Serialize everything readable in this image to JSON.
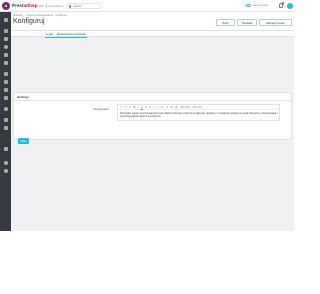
{
  "header": {
    "logo_brand": "Presta",
    "logo_brand_accent": "Shop",
    "version": "8.1",
    "quick_access": "Quick Access",
    "search_placeholder": "Search",
    "view_store": "View my store",
    "avatar_color": "#25b9d7",
    "accent": "#df0067"
  },
  "sidebar": {
    "icons": [
      "dashboard-icon",
      "orders-icon",
      "catalog-icon",
      "customers-icon",
      "support-icon",
      "stats-icon",
      "modules-icon",
      "design-icon",
      "shipping-icon",
      "payment-icon",
      "international-icon",
      "parameters-icon",
      "advanced-icon",
      "collapse-icon",
      "help-icon",
      "info-icon"
    ]
  },
  "page": {
    "breadcrumb": [
      "Modules",
      "Customer Reassurance",
      "Configure"
    ],
    "title": "Konfiguruj",
    "buttons": {
      "back": "Wróć",
      "translate": "Translate",
      "manage_hooks": "Manage hooks"
    },
    "tab": "Legal ... Reassurance Concepts"
  },
  "card": {
    "header": "Settings",
    "field_label": "Content text",
    "required_mark": "*",
    "toolbar": [
      "↶",
      "↷",
      "A",
      "B",
      "I",
      "U",
      "≡",
      "≡",
      "•",
      "1.",
      "⇤",
      "⇥",
      "⊞",
      "🔗",
      "&lt;/&gt;",
      "Format"
    ],
    "editor_text": "Wszystkie zgody na przetwarzanie wszystkich informacji i danych w zakresie zgodnym z przepisami prawa na temat zbierania, przetwarzania i przechowywania danych osobowych.",
    "save_label": "Save"
  }
}
